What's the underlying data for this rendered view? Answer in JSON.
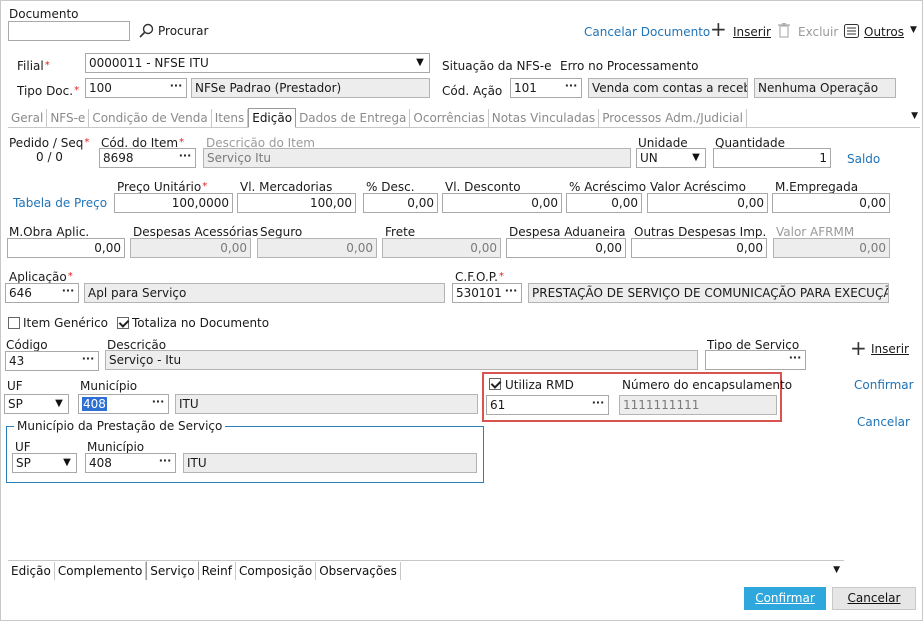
{
  "header": {
    "documento_label": "Documento",
    "documento_value": "",
    "procurar_label": "Procurar",
    "cancelar_documento": "Cancelar Documento",
    "inserir": "Inserir",
    "excluir": "Excluir",
    "outros": "Outros"
  },
  "top": {
    "filial_label": "Filial",
    "filial_value": "0000011 - NFSE ITU",
    "situacao_label": "Situação da NFS-e",
    "situacao_value": "Erro no Processamento",
    "tipo_doc_label": "Tipo Doc.",
    "tipo_doc_code": "100",
    "tipo_doc_desc": "NFSe Padrao (Prestador)",
    "cod_acao_label": "Cód. Ação",
    "cod_acao_value": "101",
    "cod_acao_desc": "Venda com contas a receber",
    "operacao_desc": "Nenhuma Operação"
  },
  "tabs": [
    "Geral",
    "NFS-e",
    "Condição de Venda",
    "Itens",
    "Edição",
    "Dados de Entrega",
    "Ocorrências",
    "Notas Vinculadas",
    "Processos Adm./Judicial"
  ],
  "item": {
    "pedido_seq_label": "Pedido / Seq",
    "pedido_seq_value": "0 / 0",
    "cod_item_label": "Cód. do Item",
    "cod_item_value": "8698",
    "descricao_item_label": "Descrição do Item",
    "descricao_item_value": "Serviço Itu",
    "unidade_label": "Unidade",
    "unidade_value": "UN",
    "quantidade_label": "Quantidade",
    "quantidade_value": "1",
    "saldo_link": "Saldo",
    "tabela_preco_link": "Tabela de Preço",
    "preco_unitario_label": "Preço Unitário",
    "preco_unitario_value": "100,0000",
    "vl_mercadorias_label": "Vl. Mercadorias",
    "vl_mercadorias_value": "100,00",
    "pct_desc_label": "% Desc.",
    "pct_desc_value": "0,00",
    "vl_desconto_label": "Vl. Desconto",
    "vl_desconto_value": "0,00",
    "pct_acrescimo_label": "% Acréscimo",
    "pct_acrescimo_value": "0,00",
    "valor_acrescimo_label": "Valor Acréscimo",
    "valor_acrescimo_value": "0,00",
    "m_empregada_label": "M.Empregada",
    "m_empregada_value": "0,00",
    "m_obra_label": "M.Obra Aplic.",
    "m_obra_value": "0,00",
    "despesas_acessorias_label": "Despesas Acessórias",
    "despesas_acessorias_value": "0,00",
    "seguro_label": "Seguro",
    "seguro_value": "0,00",
    "frete_label": "Frete",
    "frete_value": "0,00",
    "despesa_aduaneira_label": "Despesa Aduaneira",
    "despesa_aduaneira_value": "0,00",
    "outras_despesas_label": "Outras Despesas Imp.",
    "outras_despesas_value": "0,00",
    "valor_afrmm_label": "Valor AFRMM",
    "valor_afrmm_value": "0,00",
    "aplicacao_label": "Aplicação",
    "aplicacao_code": "646",
    "aplicacao_desc": "Apl para Serviço",
    "cfop_label": "C.F.O.P.",
    "cfop_code": "530101",
    "cfop_desc": "PRESTAÇÃO DE SERVIÇO DE COMUNICAÇÃO PARA EXECUÇÃO",
    "item_generico_label": "Item Genérico",
    "totaliza_label": "Totaliza no Documento"
  },
  "servico": {
    "codigo_label": "Código",
    "codigo_value": "43",
    "descricao_label": "Descrição",
    "descricao_value": "Serviço - Itu",
    "tipo_servico_label": "Tipo de Serviço",
    "tipo_servico_value": "",
    "inserir": "Inserir",
    "uf_label": "UF",
    "uf_value": "SP",
    "municipio_label": "Município",
    "municipio_code": "408",
    "municipio_desc": "ITU",
    "utiliza_rmd_label": "Utiliza RMD",
    "rmd_value": "61",
    "num_encapsulamento_label": "Número do encapsulamento",
    "num_encapsulamento_value": "1111111111",
    "confirmar": "Confirmar",
    "cancelar": "Cancelar",
    "prestacao_legend": "Município da Prestação de Serviço",
    "prest_uf_label": "UF",
    "prest_uf_value": "SP",
    "prest_municipio_label": "Município",
    "prest_municipio_code": "408",
    "prest_municipio_desc": "ITU"
  },
  "bottom_tabs": [
    "Edição",
    "Complemento",
    "Serviço",
    "Reinf",
    "Composição",
    "Observações"
  ],
  "footer": {
    "confirmar": "Confirmar",
    "cancelar": "Cancelar"
  },
  "colors": {
    "accent": "#1f73b7",
    "primary_button": "#2ea8dc",
    "highlight_box": "#d9534f",
    "required": "#e02020"
  }
}
